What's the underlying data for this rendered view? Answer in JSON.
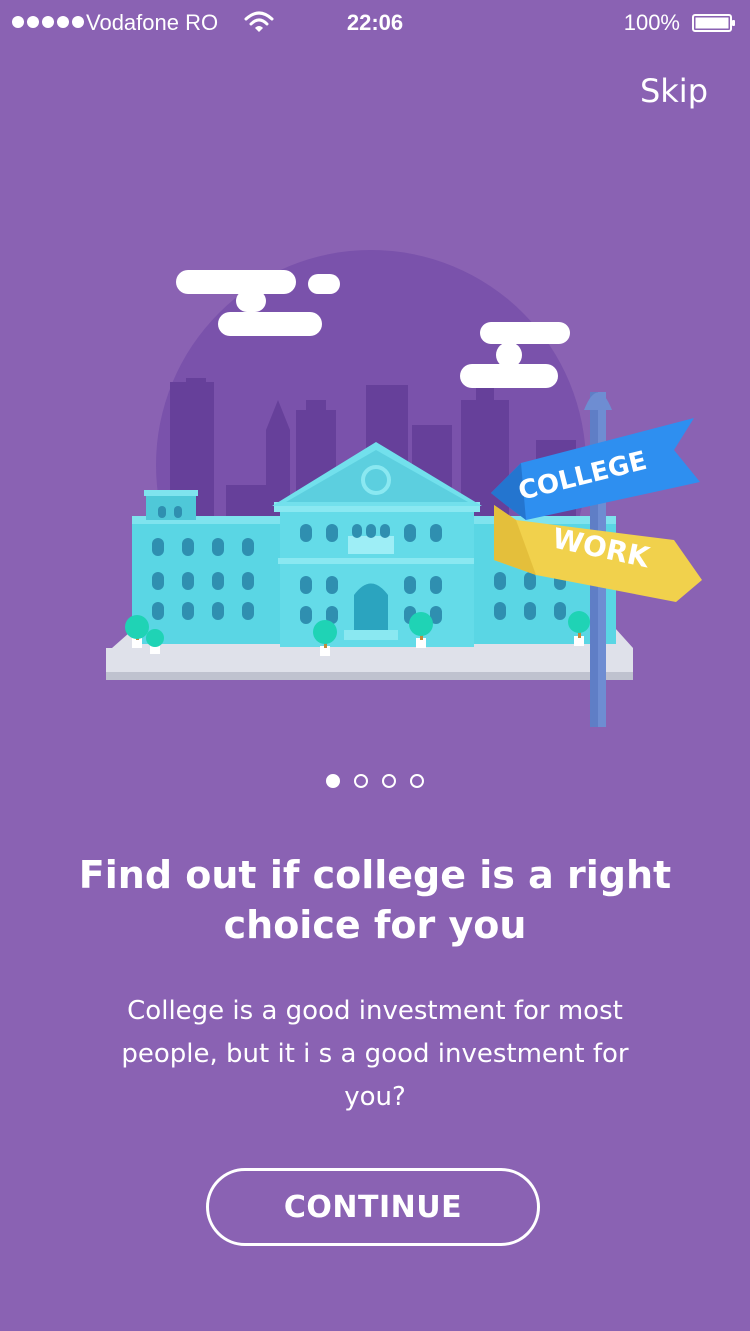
{
  "status_bar": {
    "carrier": "Vodafone RO",
    "time": "22:06",
    "battery_percent": "100%"
  },
  "header": {
    "skip_label": "Skip"
  },
  "illustration": {
    "sign_top": "COLLEGE",
    "sign_bottom": "WORK",
    "colors": {
      "background": "#8a62b3",
      "circle": "#7a52ab",
      "skyline": "#66409a",
      "building": "#5ad6e4",
      "sign_college": "#2e8ff0",
      "sign_work": "#f1d14c"
    }
  },
  "pager": {
    "total": 4,
    "active_index": 0
  },
  "content": {
    "title": "Find out if college is a right choice for you",
    "description": "College is a  good investment for most people, but it i s a good investment for you?"
  },
  "actions": {
    "continue_label": "CONTINUE"
  }
}
